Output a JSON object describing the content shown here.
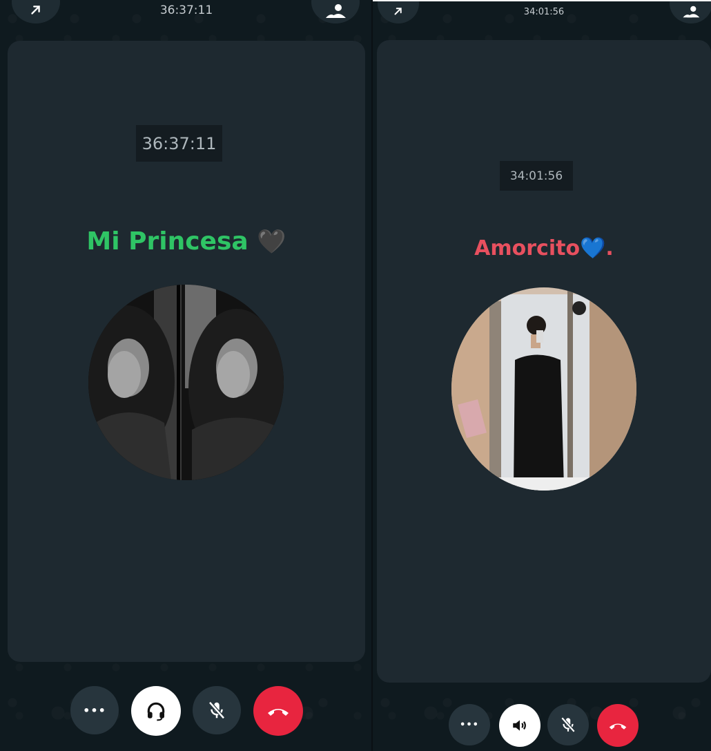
{
  "left": {
    "top_timer": "36:37:11",
    "card_timer": "36:37:11",
    "contact_name": "Mi Princesa",
    "name_emoji": "🖤",
    "name_color": "#2fc465",
    "controls": {
      "more": "•••",
      "audio_route": "headset",
      "mic": "muted",
      "end": "end-call"
    }
  },
  "right": {
    "top_timer": "34:01:56",
    "card_timer": "34:01:56",
    "contact_name": "Amorcito",
    "name_emoji": "💙",
    "name_suffix": ".",
    "name_color": "#e8505f",
    "controls": {
      "more": "•••",
      "audio_route": "speaker",
      "mic": "muted",
      "end": "end-call"
    }
  },
  "colors": {
    "end_call": "#e8253f",
    "card": "#1e2930",
    "background": "#0f1a1f"
  }
}
